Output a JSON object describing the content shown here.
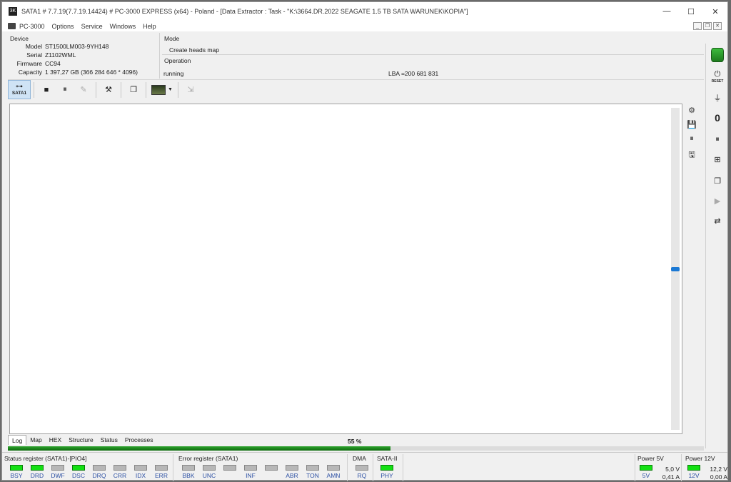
{
  "window": {
    "title": "SATA1 # 7.7.19(7.7.19.14424) # PC-3000 EXPRESS (x64) - Poland - [Data Extractor : Task - \"K:\\3664.DR.2022 SEAGATE 1.5 TB SATA WARUNEK\\KOPIA\"]",
    "app_icon_text": "3K",
    "controls": {
      "minimize": "—",
      "maximize": "☐",
      "close": "✕"
    }
  },
  "menu": {
    "items": [
      "PC-3000",
      "Options",
      "Service",
      "Windows",
      "Help"
    ],
    "mdi": [
      "_",
      "❐",
      "✕"
    ]
  },
  "device": {
    "title": "Device",
    "fields": [
      {
        "label": "Model",
        "value": "ST1500LM003-9YH148"
      },
      {
        "label": "Serial",
        "value": "Z1102WML"
      },
      {
        "label": "Firmware",
        "value": "CC94"
      },
      {
        "label": "Capacity",
        "value": "1 397,27 GB (366 284 646 * 4096)"
      }
    ]
  },
  "mode": {
    "title": "Mode",
    "value": "Create heads map"
  },
  "operation": {
    "title": "Operation",
    "status": "running",
    "lba": "LBA =200 681 831"
  },
  "toolbar": {
    "sata_label": "SATA1",
    "sata_icon": "cable-icon",
    "buttons": [
      {
        "name": "stop-button",
        "glyph": "■",
        "enabled": true
      },
      {
        "name": "pause-button",
        "glyph": "⏸",
        "enabled": true
      },
      {
        "name": "edit-disabled-button",
        "glyph": "✎",
        "enabled": false
      },
      {
        "name": "tools-button",
        "glyph": "⚒",
        "enabled": true
      },
      {
        "name": "windows-button",
        "glyph": "❐",
        "enabled": true
      },
      {
        "name": "exit-disabled-button",
        "glyph": "⇲",
        "enabled": false
      }
    ]
  },
  "side_icons": [
    "⚙",
    "💾",
    "⏸",
    "🖫"
  ],
  "right_panel": {
    "icons": [
      {
        "name": "database-icon",
        "glyph": ""
      },
      {
        "name": "reset-icon",
        "glyph": "⏻"
      },
      {
        "name": "power-icon",
        "glyph": "⏚"
      },
      {
        "name": "zero-icon",
        "glyph": "0"
      },
      {
        "name": "pause-icon",
        "glyph": "⏸"
      },
      {
        "name": "pcb-icon",
        "glyph": "⊞"
      },
      {
        "name": "copy-icon",
        "glyph": "❐"
      },
      {
        "name": "play-icon",
        "glyph": "▶"
      },
      {
        "name": "connector-icon",
        "glyph": "⇄"
      }
    ],
    "reset_label": "RESET"
  },
  "tabs": [
    "Log",
    "Map",
    "HEX",
    "Structure",
    "Status",
    "Processes"
  ],
  "progress": {
    "label": "55 %",
    "fraction": 0.55
  },
  "status_register": {
    "title": "Status register (SATA1)-[PIO4]",
    "flags": [
      {
        "name": "BSY",
        "on": true
      },
      {
        "name": "DRD",
        "on": true
      },
      {
        "name": "DWF",
        "on": false
      },
      {
        "name": "DSC",
        "on": true
      },
      {
        "name": "DRQ",
        "on": false
      },
      {
        "name": "CRR",
        "on": false
      },
      {
        "name": "IDX",
        "on": false
      },
      {
        "name": "ERR",
        "on": false
      }
    ]
  },
  "error_register": {
    "title": "Error register (SATA1)",
    "flags": [
      {
        "name": "BBK",
        "on": false
      },
      {
        "name": "UNC",
        "on": false
      },
      {
        "name": "",
        "on": false
      },
      {
        "name": "INF",
        "on": false
      },
      {
        "name": "",
        "on": false
      },
      {
        "name": "ABR",
        "on": false
      },
      {
        "name": "TON",
        "on": false
      },
      {
        "name": "AMN",
        "on": false
      }
    ]
  },
  "dma": {
    "title": "DMA",
    "flag": "RQ",
    "on": false
  },
  "sata2": {
    "title": "SATA-II",
    "flag": "PHY",
    "on": true
  },
  "power5": {
    "title": "Power 5V",
    "flag": "5V",
    "on": true,
    "voltage": "5,0 V",
    "current": "0,41 A"
  },
  "power12": {
    "title": "Power 12V",
    "flag": "12V",
    "on": true,
    "voltage": "12,2 V",
    "current": "0,00 A"
  },
  "colors": {
    "led_on": "#13e013",
    "led_off": "#b7b7b7",
    "accent": "#1a78d4",
    "progress": "#0d6a0d"
  }
}
